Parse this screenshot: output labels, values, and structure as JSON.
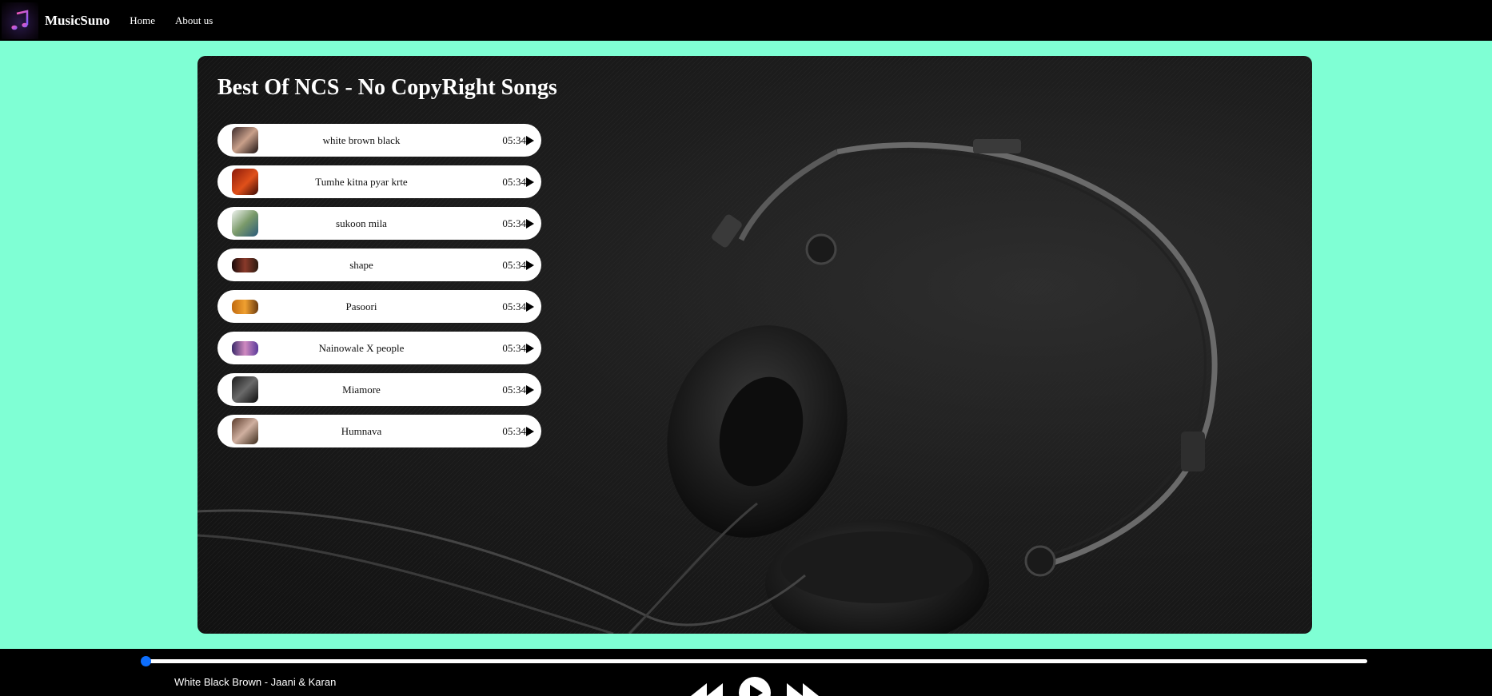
{
  "navbar": {
    "brand": "MusicSuno",
    "links": [
      "Home",
      "About us"
    ],
    "logo_icon": "music-note-icon"
  },
  "main": {
    "title": "Best Of NCS - No CopyRight Songs",
    "songs": [
      {
        "name": "white brown black",
        "duration": "05:34"
      },
      {
        "name": "Tumhe kitna pyar krte",
        "duration": "05:34"
      },
      {
        "name": "sukoon mila",
        "duration": "05:34"
      },
      {
        "name": "shape",
        "duration": "05:34"
      },
      {
        "name": "Pasoori",
        "duration": "05:34"
      },
      {
        "name": "Nainowale X people",
        "duration": "05:34"
      },
      {
        "name": "Miamore",
        "duration": "05:34"
      },
      {
        "name": "Humnava",
        "duration": "05:34"
      }
    ]
  },
  "player": {
    "now_playing": "White Black Brown - Jaani & Karan",
    "progress": 0,
    "accent": "#0d6efd"
  },
  "colors": {
    "page_bg": "#7fffd4",
    "nav_bg": "#000000"
  }
}
